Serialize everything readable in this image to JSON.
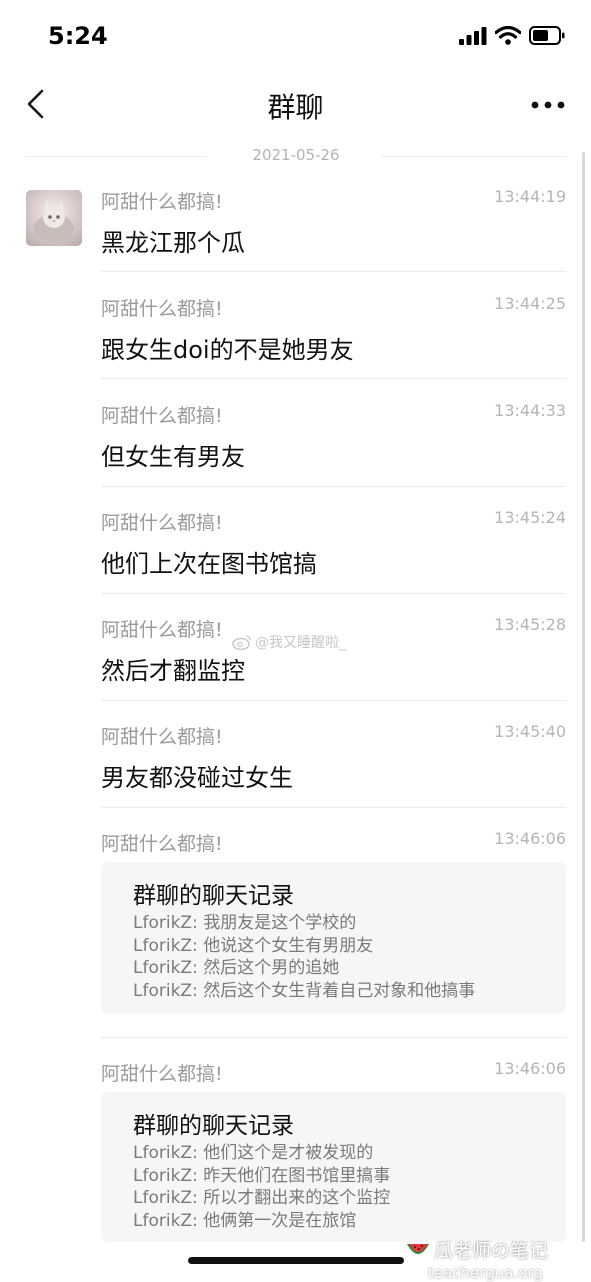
{
  "status_bar": {
    "time": "5:24",
    "icons": [
      "cellular-signal-icon",
      "wifi-icon",
      "battery-icon"
    ]
  },
  "nav": {
    "title": "群聊",
    "back_icon": "chevron-left-icon",
    "more_icon": "more-dots-icon"
  },
  "date_divider": "2021-05-26",
  "messages": [
    {
      "sender": "阿甜什么都搞!",
      "time": "13:44:19",
      "text": "黑龙江那个瓜"
    },
    {
      "sender": "阿甜什么都搞!",
      "time": "13:44:25",
      "text": "跟女生doi的不是她男友"
    },
    {
      "sender": "阿甜什么都搞!",
      "time": "13:44:33",
      "text": "但女生有男友"
    },
    {
      "sender": "阿甜什么都搞!",
      "time": "13:45:24",
      "text": "他们上次在图书馆搞"
    },
    {
      "sender": "阿甜什么都搞!",
      "time": "13:45:28",
      "text": "然后才翻监控"
    },
    {
      "sender": "阿甜什么都搞!",
      "time": "13:45:40",
      "text": "男友都没碰过女生"
    },
    {
      "sender": "阿甜什么都搞!",
      "time": "13:46:06",
      "record": {
        "title": "群聊的聊天记录",
        "lines": [
          "LforikZ: 我朋友是这个学校的",
          "LforikZ: 他说这个女生有男朋友",
          "LforikZ: 然后这个男的追她",
          "LforikZ: 然后这个女生背着自己对象和他搞事"
        ]
      }
    },
    {
      "sender": "阿甜什么都搞!",
      "time": "13:46:06",
      "record": {
        "title": "群聊的聊天记录",
        "lines": [
          "LforikZ: 他们这个是才被发现的",
          "LforikZ: 昨天他们在图书馆里搞事",
          "LforikZ: 所以才翻出来的这个监控",
          "LforikZ: 他俩第一次是在旅馆"
        ]
      }
    }
  ],
  "watermarks": {
    "weibo": "@我又睡醒啦_",
    "brand": "瓜老师の笔记",
    "url": "teachergua.org"
  }
}
